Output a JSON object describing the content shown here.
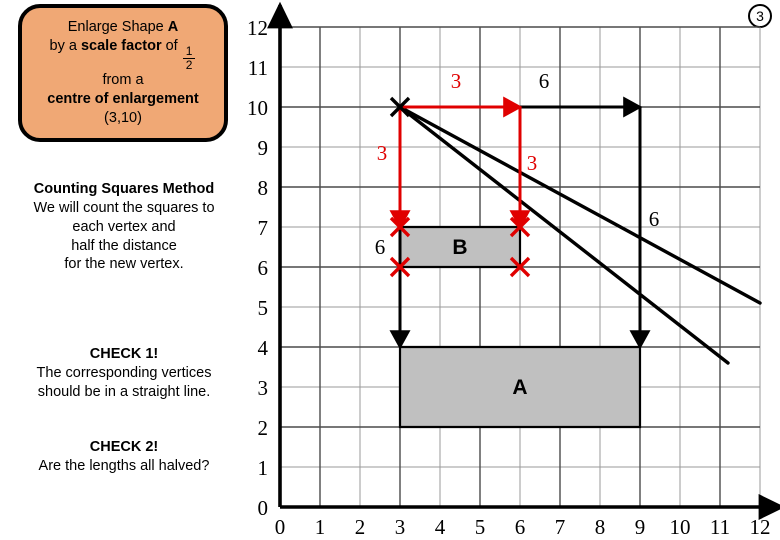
{
  "instruction": {
    "line1_prefix": "Enlarge Shape ",
    "line1_shape": "A",
    "line2_prefix": "by a ",
    "line2_bold": "scale factor",
    "line2_suffix": " of ",
    "fraction_numerator": "1",
    "fraction_denominator": "2",
    "line3": "from a",
    "line4": "centre of enlargement",
    "line5": "(3,10)"
  },
  "method": {
    "heading": "Counting Squares Method",
    "body_line1": "We will count the squares to",
    "body_line2": "each vertex and",
    "body_line3": "half the distance",
    "body_line4": "for the new vertex."
  },
  "check1": {
    "heading": "CHECK 1!",
    "body_line1": "The corresponding vertices",
    "body_line2": "should be in a straight line."
  },
  "check2": {
    "heading": "CHECK 2!",
    "body_line1": "Are the lengths all halved?"
  },
  "slide_number": "3",
  "colors": {
    "card_fill": "#f0a875",
    "shape_fill": "#c0c0c0",
    "accent_red": "#e00000",
    "ink": "#000000",
    "grid_minor": "#9a9a9a",
    "grid_major": "#4a4a4a"
  },
  "chart_data": {
    "type": "scatter",
    "title": "",
    "xlabel": "",
    "ylabel": "",
    "xlim": [
      0,
      12
    ],
    "ylim": [
      0,
      12
    ],
    "grid": true,
    "x_ticks": [
      "0",
      "1",
      "2",
      "3",
      "4",
      "5",
      "6",
      "7",
      "8",
      "9",
      "10",
      "11",
      "12"
    ],
    "y_ticks": [
      "0",
      "1",
      "2",
      "3",
      "4",
      "5",
      "6",
      "7",
      "8",
      "9",
      "10",
      "11",
      "12"
    ],
    "centre_of_enlargement": {
      "label": "centre",
      "x": 3,
      "y": 10,
      "marker": "cross"
    },
    "shapes": [
      {
        "name": "A",
        "label": "A",
        "label_x": 6,
        "label_y": 3,
        "fill": "#c0c0c0",
        "vertices": [
          [
            3,
            4
          ],
          [
            9,
            4
          ],
          [
            9,
            2
          ],
          [
            3,
            2
          ]
        ]
      },
      {
        "name": "B",
        "label": "B",
        "label_x": 4.5,
        "label_y": 6.5,
        "fill": "#c0c0c0",
        "vertices": [
          [
            3,
            7
          ],
          [
            6,
            7
          ],
          [
            6,
            6
          ],
          [
            3,
            6
          ]
        ]
      }
    ],
    "rays": [
      {
        "from": [
          3,
          10
        ],
        "to": [
          12,
          5.1
        ]
      },
      {
        "from": [
          3,
          10
        ],
        "to": [
          11.2,
          3.6
        ]
      }
    ],
    "counting_arrows": [
      {
        "color": "black",
        "from": [
          3,
          10
        ],
        "to": [
          9,
          10
        ],
        "label": "6",
        "label_x": 6.6,
        "label_y": 10.65,
        "orientation": "horizontal"
      },
      {
        "color": "black",
        "from": [
          9,
          10
        ],
        "to": [
          9,
          4
        ],
        "label": "6",
        "label_y": 7.2,
        "label_x": 9.35,
        "orientation": "vertical"
      },
      {
        "color": "black",
        "from": [
          3,
          10
        ],
        "to": [
          3,
          4
        ],
        "label": "",
        "orientation": "vertical"
      },
      {
        "color": "red",
        "from": [
          3,
          10
        ],
        "to": [
          6,
          10
        ],
        "label": "3",
        "label_x": 4.4,
        "label_y": 10.65,
        "orientation": "horizontal"
      },
      {
        "color": "red",
        "from": [
          6,
          10
        ],
        "to": [
          6,
          7
        ],
        "label": "3",
        "label_x": 6.3,
        "label_y": 8.6,
        "orientation": "vertical"
      },
      {
        "color": "red",
        "from": [
          3,
          10
        ],
        "to": [
          3,
          7
        ],
        "label": "3",
        "label_x": 2.55,
        "label_y": 8.85,
        "orientation": "vertical"
      }
    ],
    "extra_labels": [
      {
        "text": "6",
        "x": 2.5,
        "y": 6.5,
        "color": "black"
      }
    ],
    "vertex_marks": [
      {
        "x": 3,
        "y": 7,
        "color": "red"
      },
      {
        "x": 6,
        "y": 7,
        "color": "red"
      },
      {
        "x": 3,
        "y": 6,
        "color": "red"
      },
      {
        "x": 6,
        "y": 6,
        "color": "red"
      }
    ]
  }
}
